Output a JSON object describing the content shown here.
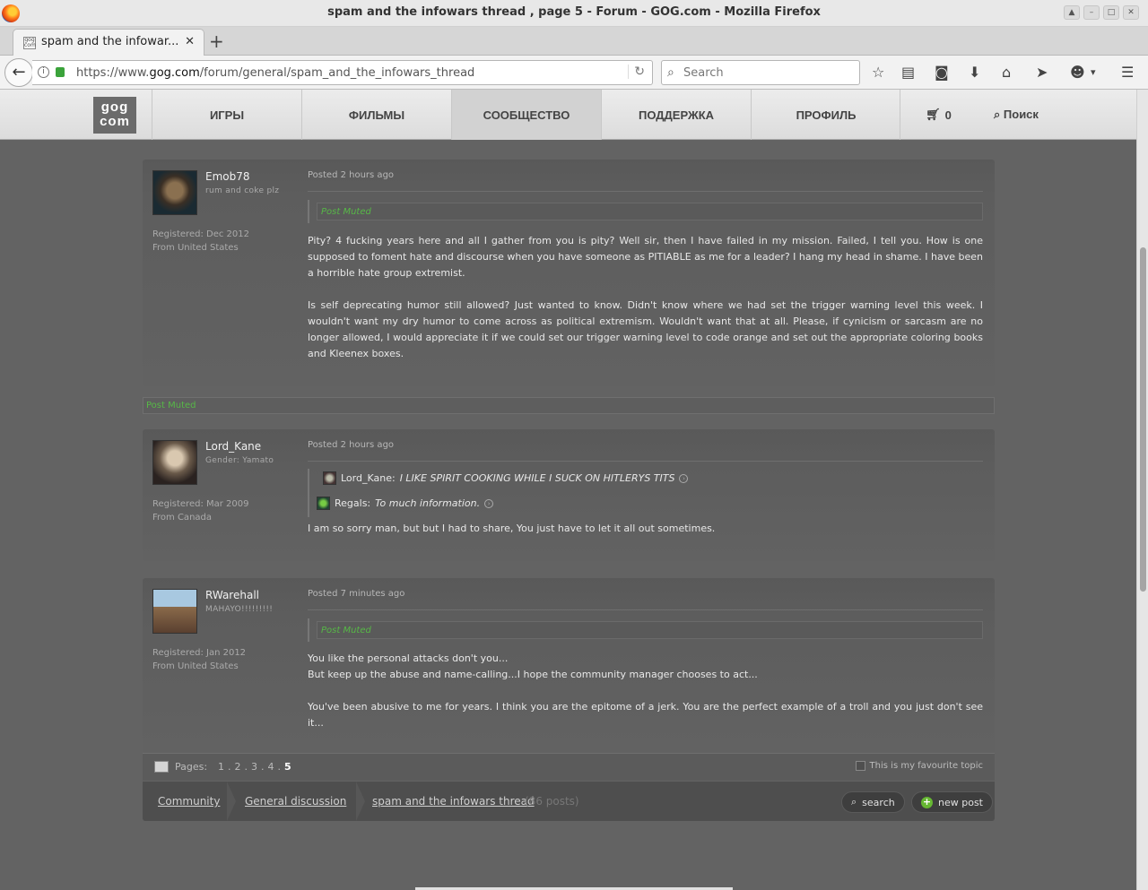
{
  "window": {
    "title": "spam and the infowars thread , page 5 - Forum - GOG.com - Mozilla Firefox"
  },
  "browser": {
    "tab_label": "spam and the infowar...",
    "url_prefix": "https://www.",
    "url_domain": "gog.com",
    "url_path": "/forum/general/spam_and_the_infowars_thread",
    "search_placeholder": "Search"
  },
  "gog": {
    "logo_line1": "gog",
    "logo_line2": "com",
    "nav": [
      "ИГРЫ",
      "ФИЛЬМЫ",
      "СООБЩЕСТВО",
      "ПОДДЕРЖКА",
      "ПРОФИЛЬ"
    ],
    "cart_count": "0",
    "search_label": "Поиск"
  },
  "posts": [
    {
      "username": "Emob78",
      "tagline": "rum and coke plz",
      "registered": "Registered: Dec 2012",
      "from": "From United States",
      "posted": "Posted 2 hours ago",
      "muted_quote": "Post Muted",
      "paragraphs": [
        "Pity? 4 fucking years here and all I gather from you is pity? Well sir, then I have failed in my mission. Failed, I tell you. How is one supposed to foment hate and discourse when you have someone as PITIABLE as me for a leader? I hang my head in shame. I have been a horrible hate group extremist.",
        "Is self deprecating humor still allowed? Just wanted to know. Didn't know where we had set the trigger warning level this week. I wouldn't want my dry humor to come across as political extremism. Wouldn't want that at all. Please, if cynicism or sarcasm are no longer allowed, I would appreciate it if we could set our trigger warning level to code orange and set out the appropriate coloring books and Kleenex boxes."
      ]
    },
    {
      "username": "Lord_Kane",
      "tagline": "Gender: Yamato",
      "registered": "Registered: Mar 2009",
      "from": "From Canada",
      "posted": "Posted 2 hours ago",
      "quote1_author": "Lord_Kane:",
      "quote1_text": "I LIKE SPIRIT COOKING WHILE I SUCK ON HITLERYS TITS",
      "quote2_author": "Regals:",
      "quote2_text": "To much information.",
      "paragraphs": [
        "I am so sorry man, but but I had to share, You just have to let it all out sometimes."
      ]
    },
    {
      "username": "RWarehall",
      "tagline": "MAHAYO!!!!!!!!!",
      "registered": "Registered: Jan 2012",
      "from": "From United States",
      "posted": "Posted 7 minutes ago",
      "muted_quote": "Post Muted",
      "line1": "You like the personal attacks don't you...",
      "line2": "But keep up the abuse and name-calling...I hope the community manager chooses to act...",
      "line3": "You've been abusive to me for years. I think you are the epitome of a jerk. You are the perfect example of a troll and you just don't see it..."
    }
  ],
  "muted_post_bar": "Post Muted",
  "pager": {
    "label": "Pages:",
    "pages": [
      "1",
      "2",
      "3",
      "4"
    ],
    "current": "5",
    "favourite_label": "This is my favourite topic"
  },
  "breadcrumb": {
    "community": "Community",
    "general": "General discussion",
    "thread": "spam and the infowars thread",
    "count": "(86 posts)"
  },
  "actions": {
    "search": "search",
    "new_post": "new post"
  }
}
